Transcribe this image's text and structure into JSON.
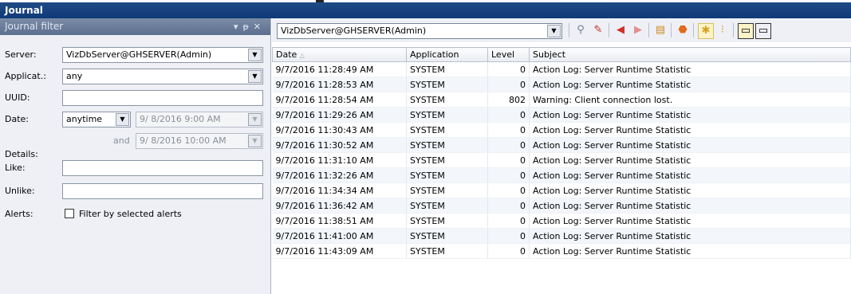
{
  "window": {
    "title": "Journal"
  },
  "filter_panel": {
    "title": "Journal filter",
    "server": {
      "label": "Server:",
      "value": "VizDbServer@GHSERVER(Admin)"
    },
    "application": {
      "label": "Applicat.:",
      "value": "any"
    },
    "uuid": {
      "label": "UUID:",
      "value": ""
    },
    "date": {
      "label": "Date:",
      "mode": "anytime",
      "from": "9/ 8/2016  9:00 AM",
      "and_label": "and",
      "to": "9/ 8/2016 10:00 AM"
    },
    "details_label": "Details:",
    "like": {
      "label": "Like:",
      "value": ""
    },
    "unlike": {
      "label": "Unlike:",
      "value": ""
    },
    "alerts": {
      "label": "Alerts:",
      "checkbox_label": "Filter by selected alerts",
      "checked": false
    }
  },
  "toolbar": {
    "server_select": "VizDbServer@GHSERVER(Admin)",
    "icons": [
      "search-icon",
      "edit-filter-icon",
      "back-icon",
      "forward-icon",
      "report-icon",
      "stop-icon",
      "alert-icon",
      "details-icon",
      "panel-left-icon",
      "panel-right-icon"
    ]
  },
  "log_table": {
    "columns": [
      "Date",
      "Application",
      "Level",
      "Subject"
    ],
    "rows": [
      [
        "9/7/2016 11:28:49 AM",
        "SYSTEM",
        "0",
        "Action Log: Server Runtime Statistic"
      ],
      [
        "9/7/2016 11:28:53 AM",
        "SYSTEM",
        "0",
        "Action Log: Server Runtime Statistic"
      ],
      [
        "9/7/2016 11:28:54 AM",
        "SYSTEM",
        "802",
        "Warning: Client connection lost."
      ],
      [
        "9/7/2016 11:29:26 AM",
        "SYSTEM",
        "0",
        "Action Log: Server Runtime Statistic"
      ],
      [
        "9/7/2016 11:30:43 AM",
        "SYSTEM",
        "0",
        "Action Log: Server Runtime Statistic"
      ],
      [
        "9/7/2016 11:30:52 AM",
        "SYSTEM",
        "0",
        "Action Log: Server Runtime Statistic"
      ],
      [
        "9/7/2016 11:31:10 AM",
        "SYSTEM",
        "0",
        "Action Log: Server Runtime Statistic"
      ],
      [
        "9/7/2016 11:32:26 AM",
        "SYSTEM",
        "0",
        "Action Log: Server Runtime Statistic"
      ],
      [
        "9/7/2016 11:34:34 AM",
        "SYSTEM",
        "0",
        "Action Log: Server Runtime Statistic"
      ],
      [
        "9/7/2016 11:36:42 AM",
        "SYSTEM",
        "0",
        "Action Log: Server Runtime Statistic"
      ],
      [
        "9/7/2016 11:38:51 AM",
        "SYSTEM",
        "0",
        "Action Log: Server Runtime Statistic"
      ],
      [
        "9/7/2016 11:41:00 AM",
        "SYSTEM",
        "0",
        "Action Log: Server Runtime Statistic"
      ],
      [
        "9/7/2016 11:43:09 AM",
        "SYSTEM",
        "0",
        "Action Log: Server Runtime Statistic"
      ]
    ]
  }
}
